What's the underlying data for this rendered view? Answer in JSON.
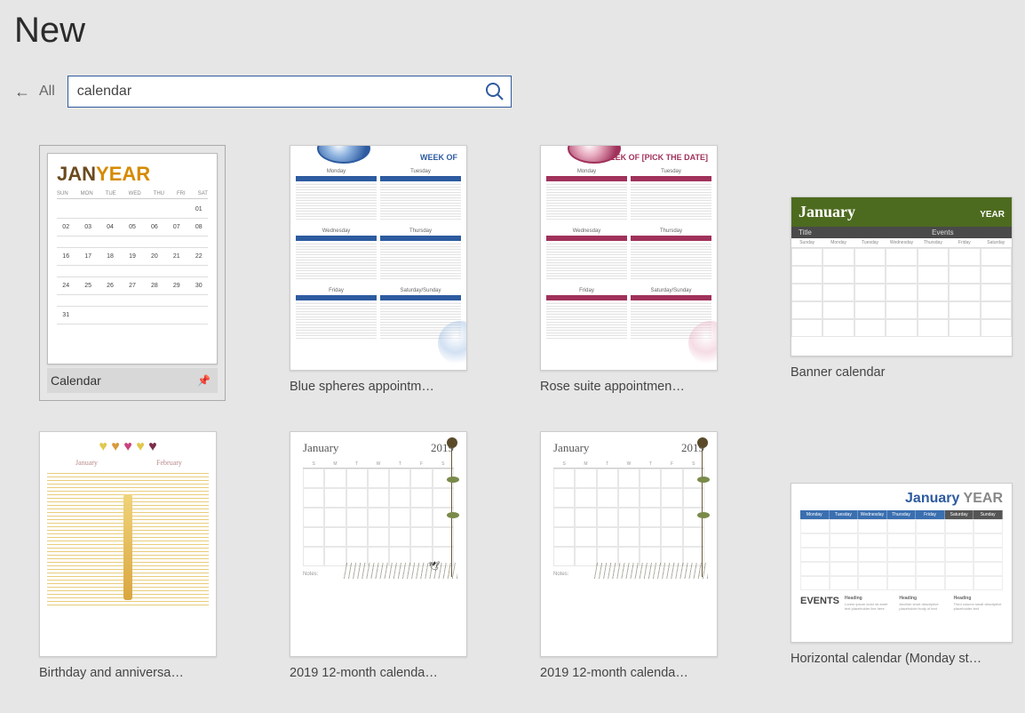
{
  "page_title": "New",
  "back_label": "All",
  "search": {
    "value": "calendar"
  },
  "templates": [
    {
      "label": "Calendar",
      "selected": true,
      "pinned": true,
      "t1": {
        "month": "JAN",
        "year": "YEAR",
        "days": [
          "SUN",
          "MON",
          "TUE",
          "WED",
          "THU",
          "FRI",
          "SAT"
        ],
        "weeks": [
          [
            "",
            "",
            "",
            "",
            "",
            "",
            "01"
          ],
          [
            "02",
            "03",
            "04",
            "05",
            "06",
            "07",
            "08"
          ],
          [
            "",
            "",
            "",
            "",
            "",
            "",
            ""
          ],
          [
            "16",
            "17",
            "18",
            "19",
            "20",
            "21",
            "22"
          ],
          [
            "",
            "",
            "",
            "",
            "",
            "",
            ""
          ],
          [
            "24",
            "25",
            "26",
            "27",
            "28",
            "29",
            "30"
          ],
          [
            "",
            "",
            "",
            "",
            "",
            "",
            ""
          ],
          [
            "31",
            "",
            "",
            "",
            "",
            "",
            ""
          ]
        ]
      }
    },
    {
      "label": "Blue spheres appointm…",
      "appt": {
        "week": "WEEK OF",
        "color1": "#8fb4e0",
        "color2": "#2d5ba0",
        "blocks": [
          "Monday",
          "Tuesday",
          "Wednesday",
          "Thursday",
          "Friday",
          "Saturday/Sunday"
        ]
      }
    },
    {
      "label": "Rose suite appointmen…",
      "appt": {
        "week": "WEEK OF [PICK THE DATE]",
        "color1": "#e6a8bd",
        "color2": "#a0315a",
        "blocks": [
          "Monday",
          "Tuesday",
          "Wednesday",
          "Thursday",
          "Friday",
          "Saturday/Sunday"
        ]
      }
    },
    {
      "label": "Banner calendar",
      "wide": true,
      "t4": {
        "month": "January",
        "year": "YEAR",
        "sub1": "Title",
        "sub2": "Events",
        "days": [
          "Sunday",
          "Monday",
          "Tuesday",
          "Wednesday",
          "Thursday",
          "Friday",
          "Saturday"
        ]
      }
    },
    {
      "label": "Birthday and anniversa…",
      "t5": {
        "m1": "January",
        "m2": "February"
      }
    },
    {
      "label": "2019 12-month calenda…",
      "t6": {
        "month": "January",
        "year": "2019",
        "notes": "Notes:",
        "bird": true
      }
    },
    {
      "label": "2019 12-month calenda…",
      "t6": {
        "month": "January",
        "year": "2019",
        "notes": "Notes:",
        "bird": false
      }
    },
    {
      "label": "Horizontal calendar (Monday st…",
      "wide": true,
      "t8": {
        "month": "January",
        "year": "YEAR",
        "events": "EVENTS",
        "days": [
          "Monday",
          "Tuesday",
          "Wednesday",
          "Thursday",
          "Friday",
          "Saturday",
          "Sunday"
        ],
        "cols": [
          {
            "h": "Heading",
            "t": "Lorem ipsum dolor sit amet text placeholder line here"
          },
          {
            "h": "Heading",
            "t": "Another short descriptive placeholder body of text"
          },
          {
            "h": "Heading",
            "t": "Third column small descriptive placeholder text"
          }
        ]
      }
    }
  ]
}
